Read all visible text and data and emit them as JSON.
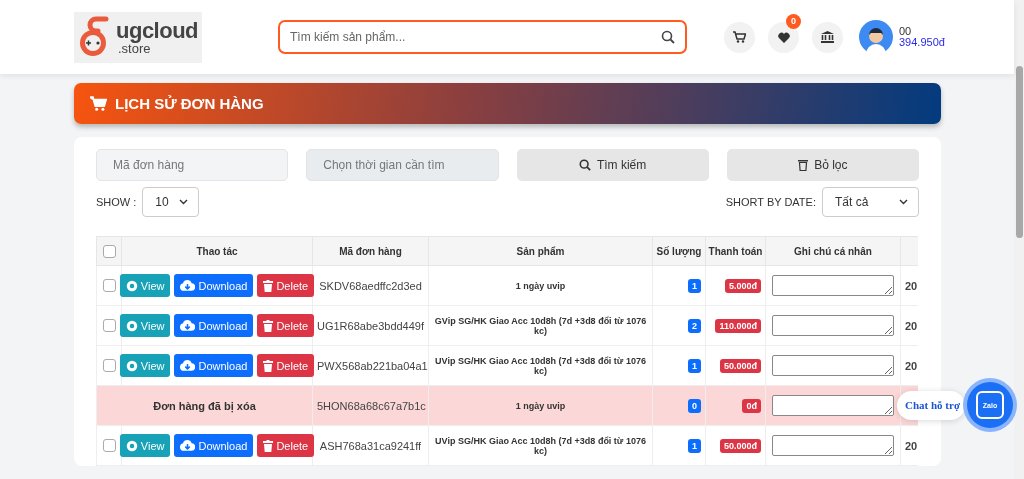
{
  "header": {
    "logo": {
      "name": "ugcloud",
      "suffix": ".store"
    },
    "search": {
      "placeholder": "Tìm kiếm sản phẩm..."
    },
    "wishlist_badge": "0",
    "user": {
      "name": "00",
      "balance": "394.950đ"
    }
  },
  "banner": {
    "title": "LỊCH SỬ ĐƠN HÀNG"
  },
  "filters": {
    "order_code": {
      "placeholder": "Mã đơn hàng"
    },
    "date": {
      "placeholder": "Chọn thời gian cần tìm"
    },
    "search_button": "Tìm kiếm",
    "clear_button": "Bỏ lọc"
  },
  "show": {
    "label": "SHOW :",
    "value": "10"
  },
  "sort": {
    "label": "SHORT BY DATE:",
    "value": "Tất cả"
  },
  "table": {
    "select_all_checked": false,
    "columns": [
      "Thao tác",
      "Mã đơn hàng",
      "Sản phẩm",
      "Số lượng",
      "Thanh toán",
      "Ghi chú cá nhân"
    ],
    "rows": [
      {
        "kind": "order",
        "checked": false,
        "actions": [
          {
            "kind": "view",
            "label": "View"
          },
          {
            "kind": "download",
            "label": "Download"
          },
          {
            "kind": "delete",
            "label": "Delete"
          }
        ],
        "code": "SKDV68aedffc2d3ed",
        "product": "1 ngày uvip",
        "quantity": "1",
        "total": "5.000đ",
        "column_8": "20"
      },
      {
        "kind": "order",
        "checked": false,
        "actions": [
          {
            "kind": "view",
            "label": "View"
          },
          {
            "kind": "download",
            "label": "Download"
          },
          {
            "kind": "delete",
            "label": "Delete"
          }
        ],
        "code": "UG1R68abe3bdd449f",
        "product": "GVip SG/HK Giao Acc 10d8h (7d +3d8 đổi từ 1076 kc)",
        "quantity": "2",
        "total": "110.000đ",
        "column_8": "20"
      },
      {
        "kind": "order",
        "checked": false,
        "actions": [
          {
            "kind": "view",
            "label": "View"
          },
          {
            "kind": "download",
            "label": "Download"
          },
          {
            "kind": "delete",
            "label": "Delete"
          }
        ],
        "code": "PWX568ab221ba04a1",
        "product": "UVip SG/HK Giao Acc 10d8h (7d +3d8 đổi từ 1076 kc)",
        "quantity": "1",
        "total": "50.000đ",
        "column_8": "20"
      },
      {
        "kind": "deleted",
        "status": "Đơn hàng đã bị xóa",
        "code": "5HON68a68c67a7b1c",
        "product": "1 ngày uvip",
        "quantity": "0",
        "total": "0đ"
      },
      {
        "kind": "order",
        "checked": false,
        "actions": [
          {
            "kind": "view",
            "label": "View"
          },
          {
            "kind": "download",
            "label": "Download"
          },
          {
            "kind": "delete",
            "label": "Delete"
          }
        ],
        "code": "ASH768a31ca9241ff",
        "product": "UVip SG/HK Giao Acc 10d8h (7d +3d8 đổi từ 1076 kc)",
        "quantity": "1",
        "total": "50.000đ",
        "column_8": "20"
      }
    ]
  },
  "chat": {
    "label": "Chat hỗ trợ",
    "logo": "Zalo"
  }
}
